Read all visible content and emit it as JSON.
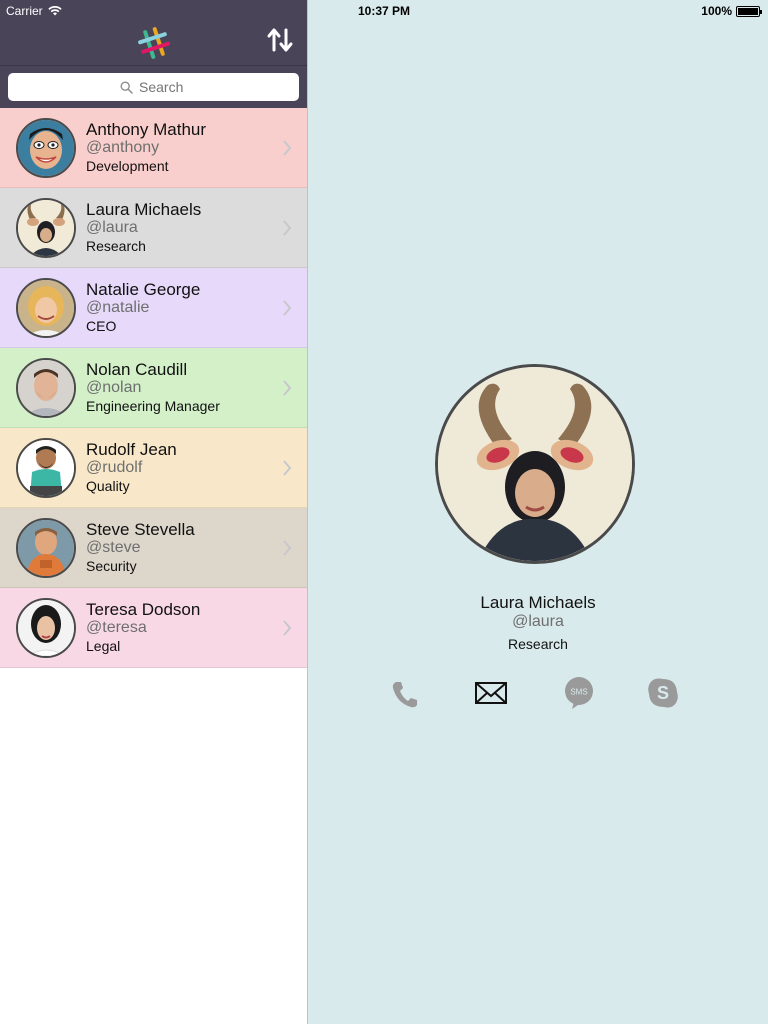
{
  "status_bar": {
    "carrier": "Carrier",
    "time": "10:37 PM",
    "battery": "100%"
  },
  "header": {
    "logo_icon": "slack-logo-icon",
    "sort_icon": "sort-arrows-icon"
  },
  "search": {
    "placeholder": "Search"
  },
  "contacts": [
    {
      "name": "Anthony Mathur",
      "handle": "@anthony",
      "role": "Development",
      "color": "#f9cfcd"
    },
    {
      "name": "Laura Michaels",
      "handle": "@laura",
      "role": "Research",
      "color": "#dcdcdc"
    },
    {
      "name": "Natalie George",
      "handle": "@natalie",
      "role": "CEO",
      "color": "#e6d9fa"
    },
    {
      "name": "Nolan Caudill",
      "handle": "@nolan",
      "role": "Engineering Manager",
      "color": "#d3f0c9"
    },
    {
      "name": "Rudolf Jean",
      "handle": "@rudolf",
      "role": "Quality",
      "color": "#f8e8c9"
    },
    {
      "name": "Steve Stevella",
      "handle": "@steve",
      "role": "Security",
      "color": "#dcd6cb"
    },
    {
      "name": "Teresa Dodson",
      "handle": "@teresa",
      "role": "Legal",
      "color": "#f9d8e6"
    }
  ],
  "detail": {
    "name": "Laura Michaels",
    "handle": "@laura",
    "role": "Research",
    "actions": [
      {
        "name": "phone-icon",
        "active": false
      },
      {
        "name": "mail-icon",
        "active": true
      },
      {
        "name": "sms-icon",
        "label": "SMS",
        "active": false
      },
      {
        "name": "skype-icon",
        "label": "S",
        "active": false
      }
    ]
  },
  "colors": {
    "nav_bg": "#4a4459",
    "detail_bg": "#d9eaec",
    "icon_inactive": "#9a9a9a",
    "icon_active": "#111111"
  }
}
